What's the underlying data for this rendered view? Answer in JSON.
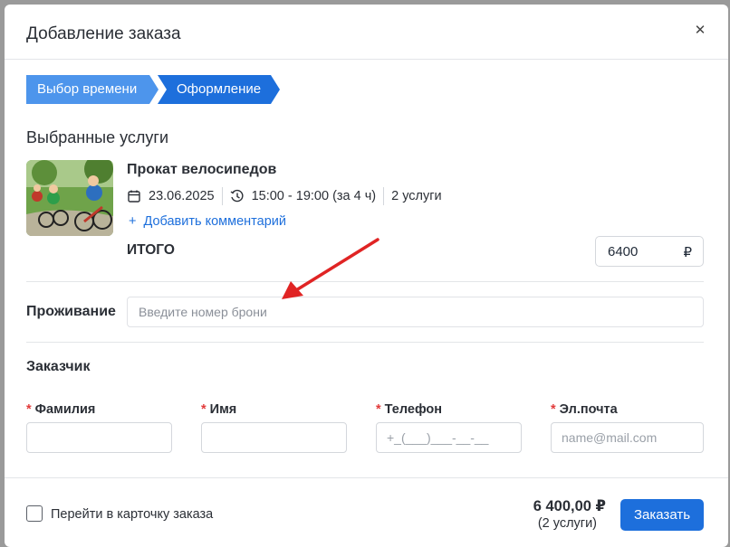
{
  "modal": {
    "title": "Добавление заказа",
    "close_icon": "close-icon"
  },
  "steps": [
    {
      "label": "Выбор времени"
    },
    {
      "label": "Оформление"
    }
  ],
  "services": {
    "title": "Выбранные услуги",
    "item": {
      "name": "Прокат велосипедов",
      "date": "23.06.2025",
      "time": "15:00 - 19:00 (за 4 ч)",
      "count": "2 услуги",
      "add_comment": "Добавить комментарий"
    },
    "total_label": "ИТОГО",
    "total_value": "6400",
    "currency": "₽"
  },
  "stay": {
    "label": "Проживание",
    "placeholder": "Введите номер брони"
  },
  "customer": {
    "title": "Заказчик",
    "fields": [
      {
        "label": "Фамилия",
        "placeholder": ""
      },
      {
        "label": "Имя",
        "placeholder": ""
      },
      {
        "label": "Телефон",
        "placeholder": "+_(___)___-__-__"
      },
      {
        "label": "Эл.почта",
        "placeholder": "name@mail.com"
      }
    ],
    "required_mark": "*"
  },
  "footer": {
    "checkbox_label": "Перейти в карточку заказа",
    "amount": "6 400,00 ₽",
    "count": "(2 услуги)",
    "order_button": "Заказать"
  },
  "colors": {
    "primary": "#1d6fdc",
    "step_inactive": "#4d95ec",
    "required": "#e23b3b",
    "annotation_arrow": "#e02424"
  }
}
